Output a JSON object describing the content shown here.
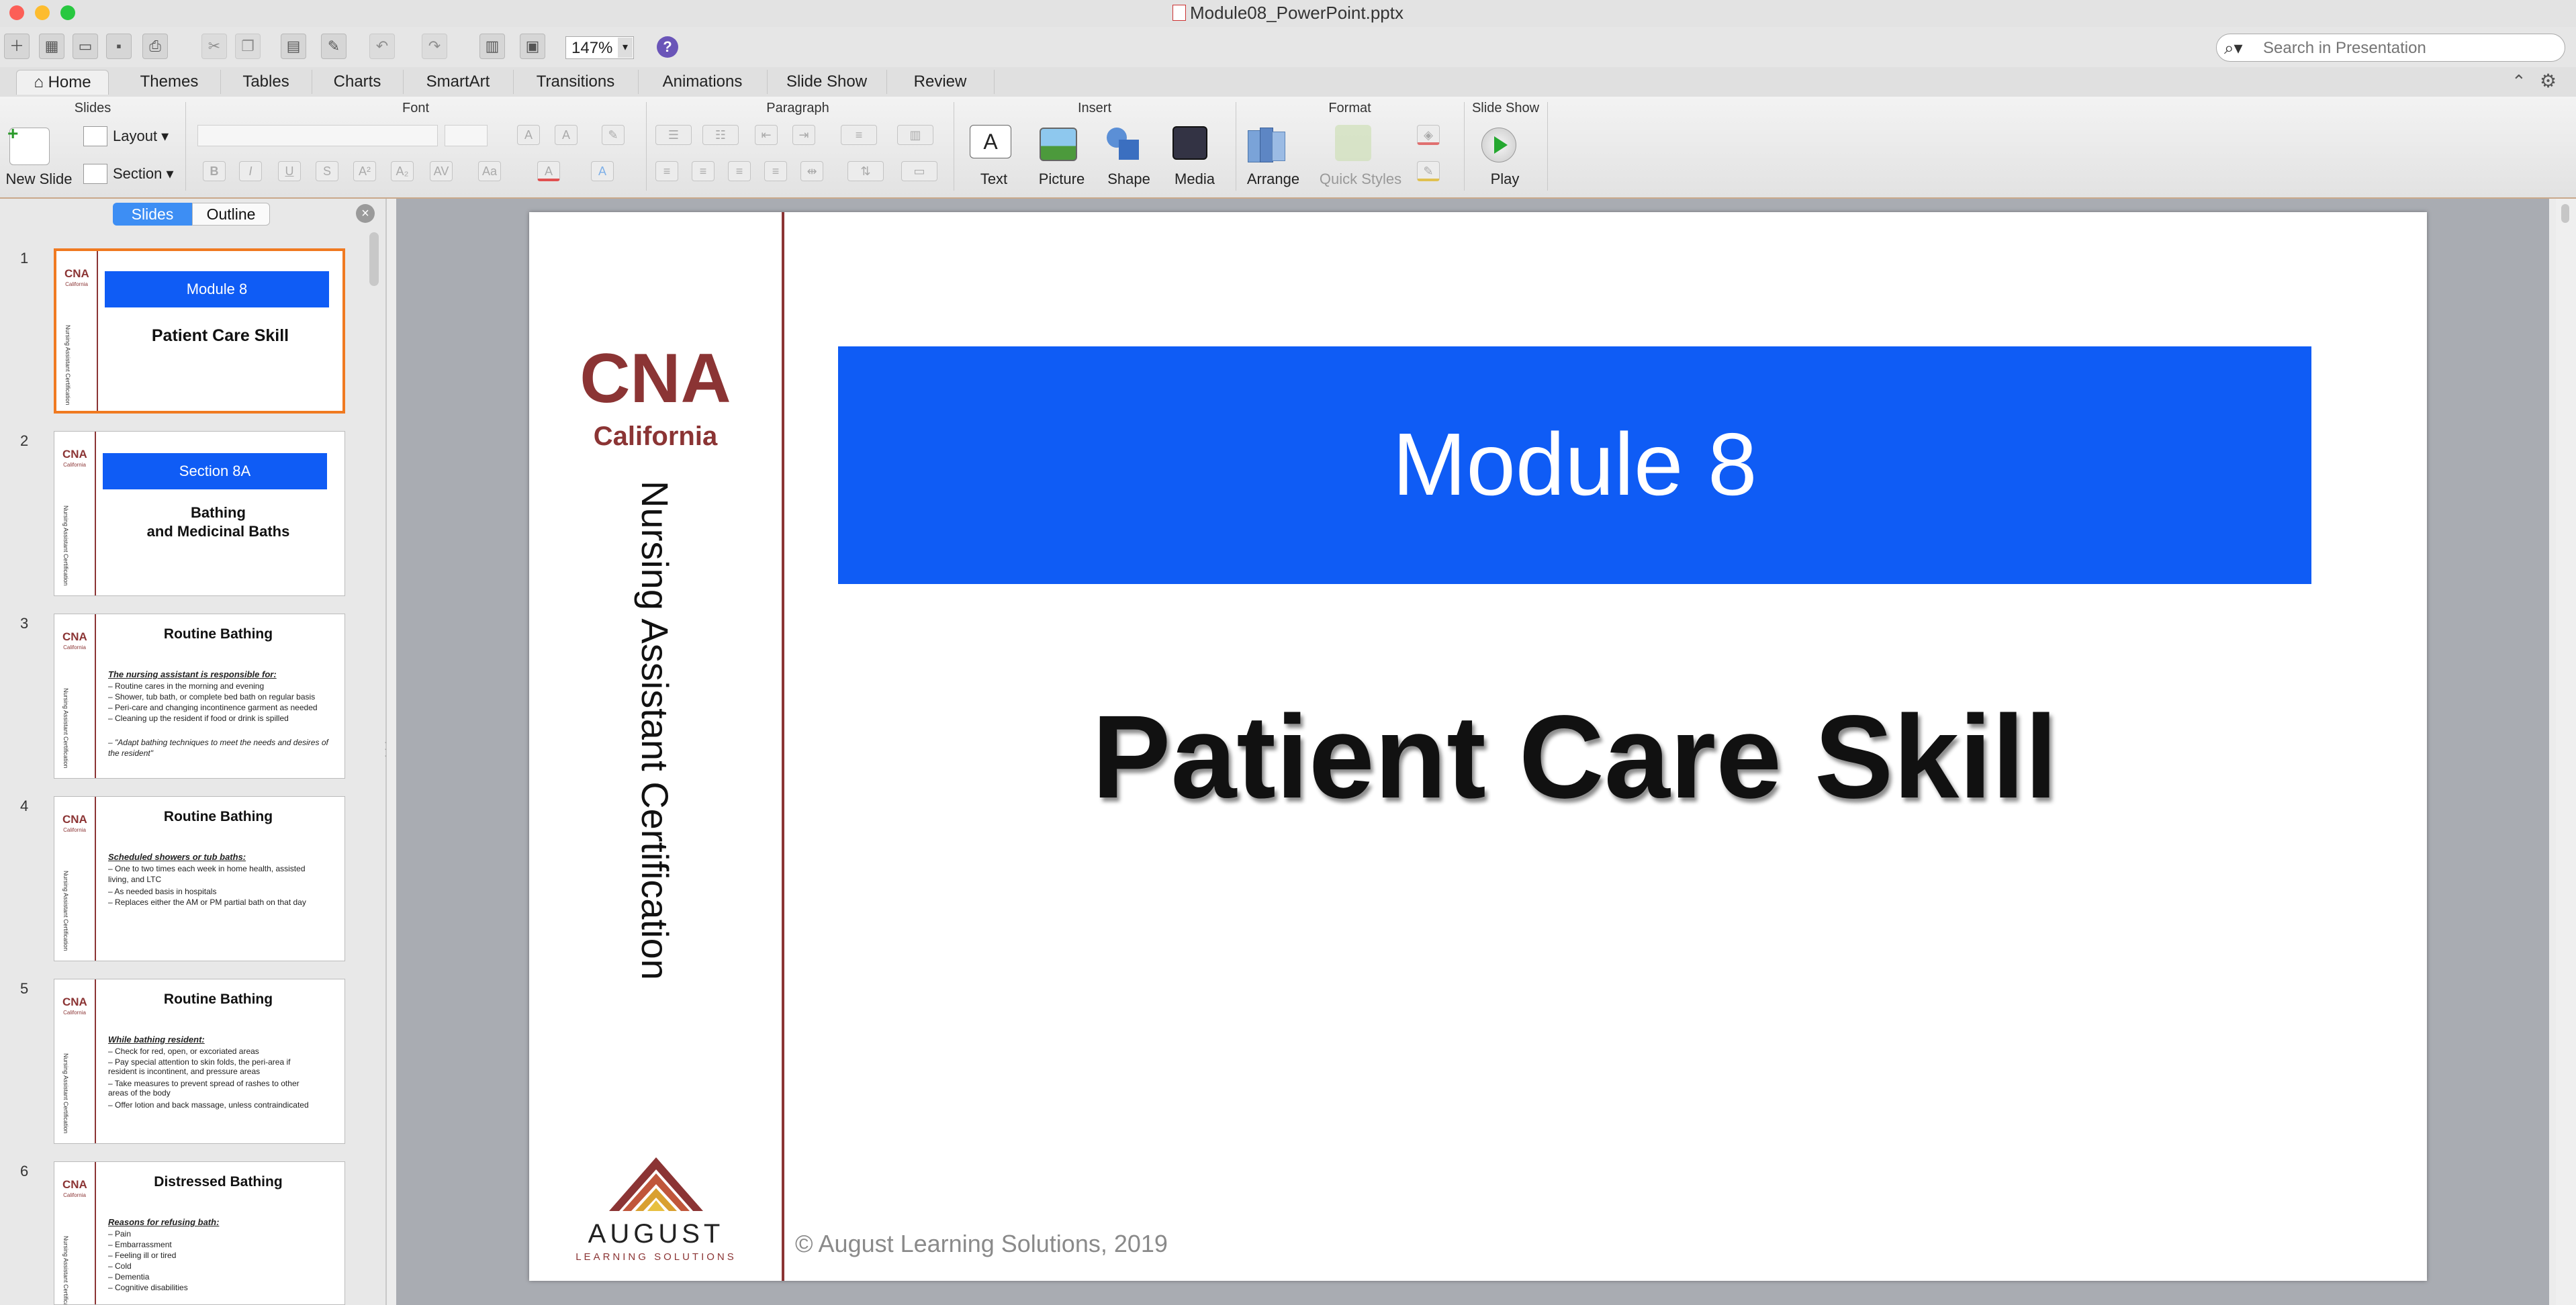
{
  "window": {
    "title": "Module08_PowerPoint.pptx"
  },
  "toolbar": {
    "zoom": "147%",
    "search_placeholder": "Search in Presentation"
  },
  "tabs": [
    "Home",
    "Themes",
    "Tables",
    "Charts",
    "SmartArt",
    "Transitions",
    "Animations",
    "Slide Show",
    "Review"
  ],
  "ribbon": {
    "groups": {
      "slides": "Slides",
      "font": "Font",
      "paragraph": "Paragraph",
      "insert": "Insert",
      "format": "Format",
      "slide_show": "Slide Show"
    },
    "new_slide": "New Slide",
    "layout": "Layout",
    "section": "Section",
    "text": "Text",
    "picture": "Picture",
    "shape": "Shape",
    "media": "Media",
    "arrange": "Arrange",
    "quick_styles": "Quick Styles",
    "play": "Play"
  },
  "pane": {
    "slides_tab": "Slides",
    "outline_tab": "Outline"
  },
  "thumbnails": [
    {
      "num": "1",
      "band": "Module 8",
      "title": "Patient Care Skill"
    },
    {
      "num": "2",
      "band": "Section 8A",
      "title1": "Bathing",
      "title2": "and Medicinal Baths"
    },
    {
      "num": "3",
      "title": "Routine Bathing",
      "lines": [
        "The nursing assistant is responsible for:",
        "– Routine cares in the morning and evening",
        "– Shower, tub bath, or complete bed bath on regular basis",
        "– Peri-care and changing incontinence garment as needed",
        "– Cleaning up the resident if food or drink is spilled",
        "– \"Adapt bathing techniques to meet the needs and desires of",
        "   the resident\""
      ]
    },
    {
      "num": "4",
      "title": "Routine Bathing",
      "lines": [
        "Scheduled showers or tub baths:",
        "– One to two times each week in home health, assisted",
        "   living, and LTC",
        "– As needed basis in hospitals",
        "– Replaces either the AM or PM partial bath on that day"
      ]
    },
    {
      "num": "5",
      "title": "Routine Bathing",
      "lines": [
        "While bathing resident:",
        "– Check for red, open, or excoriated areas",
        "– Pay special attention to skin folds, the peri-area if",
        "   resident is incontinent, and pressure areas",
        "– Take measures to prevent spread of rashes to other",
        "   areas of the body",
        "– Offer lotion and back massage, unless contraindicated"
      ]
    },
    {
      "num": "6",
      "title": "Distressed Bathing",
      "lines": [
        "Reasons for refusing bath:",
        "– Pain",
        "– Embarrassment",
        "– Feeling ill or tired",
        "– Cold",
        "– Dementia",
        "– Cognitive disabilities"
      ]
    }
  ],
  "thumb_logo": {
    "cna": "CNA",
    "ca": "California",
    "vert": "Nursing Assistant Certification"
  },
  "slide": {
    "cna": "CNA",
    "california": "California",
    "vertical": "Nursing Assistant Certification",
    "band": "Module 8",
    "title": "Patient Care Skill",
    "copyright": "© August Learning Solutions, 2019",
    "logo_top": "AUGUST",
    "logo_bottom": "LEARNING SOLUTIONS"
  },
  "colors": {
    "accent_orange": "#f07a21",
    "band_blue": "#0f5cf5",
    "cna_red": "#8b3434",
    "seg_blue": "#3d8ef4"
  }
}
